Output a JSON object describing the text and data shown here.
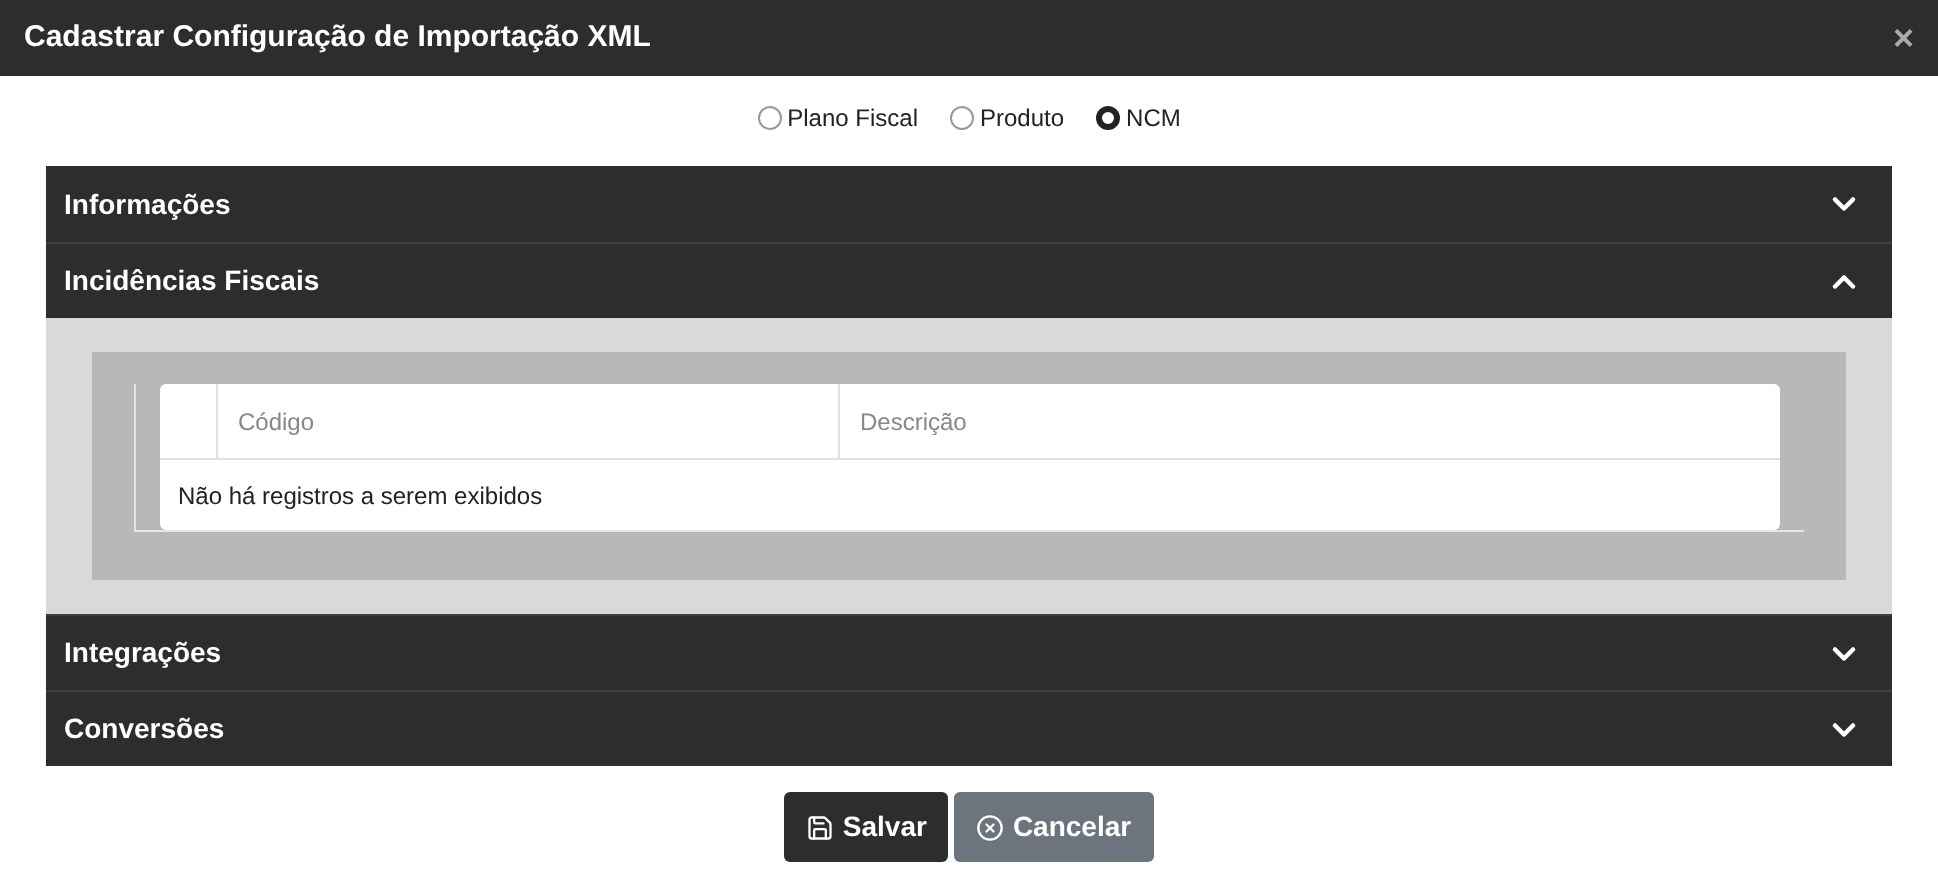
{
  "window": {
    "title": "Cadastrar Configuração de Importação XML",
    "close": "×"
  },
  "radios": [
    {
      "label": "Plano Fiscal",
      "selected": false
    },
    {
      "label": "Produto",
      "selected": false
    },
    {
      "label": "NCM",
      "selected": true
    }
  ],
  "sections": [
    {
      "title": "Informações",
      "expanded": false
    },
    {
      "title": "Incidências Fiscais",
      "expanded": true,
      "table": {
        "columns": [
          "Código",
          "Descrição"
        ],
        "empty_message": "Não há registros a serem exibidos"
      }
    },
    {
      "title": "Integrações",
      "expanded": false
    },
    {
      "title": "Conversões",
      "expanded": false
    }
  ],
  "buttons": [
    {
      "kind": "save",
      "label": "Salvar"
    },
    {
      "kind": "cancel",
      "label": "Cancelar"
    }
  ]
}
